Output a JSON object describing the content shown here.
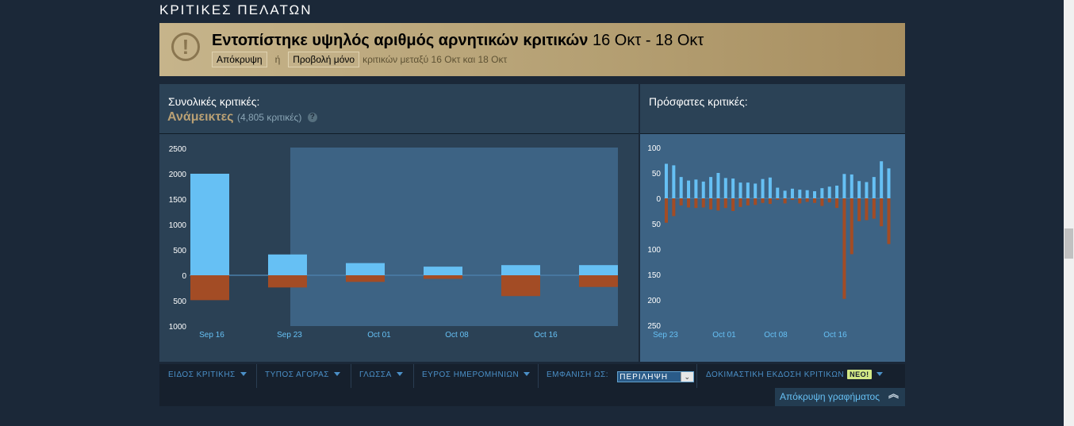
{
  "section_title": "ΚΡΙΤΙΚΕΣ ΠΕΛΑΤΩΝ",
  "warning": {
    "title_bold": "Εντοπίστηκε υψηλός αριθμός αρνητικών κριτικών",
    "date_range": "16 Οκτ - 18 Οκτ",
    "hide_button": "Απόκρυψη",
    "or_text": "ή",
    "show_only_button": "Προβολή μόνο",
    "range_note": "κριτικών μεταξύ 16 Οκτ και 18 Οκτ",
    "icon": "exclamation-circle-icon"
  },
  "overall": {
    "label": "Συνολικές κριτικές:",
    "summary": "Ανάμεικτες",
    "count": "(4,805 κριτικές)",
    "help": "?"
  },
  "recent": {
    "label": "Πρόσφατες κριτικές:"
  },
  "chart_data": [
    {
      "type": "bar",
      "title": "Συνολικές κριτικές",
      "y_ticks_positive": [
        "2500",
        "2000",
        "1500",
        "1000",
        "500",
        "0"
      ],
      "y_ticks_negative": [
        "500",
        "1000"
      ],
      "ylim": [
        -1000,
        2500
      ],
      "x_labels": [
        "Sep 16",
        "Sep 23",
        "Oct 01",
        "Oct 08",
        "Oct 16"
      ],
      "highlight_range": [
        "Sep 23",
        "Oct 16+"
      ],
      "series": [
        {
          "name": "positive",
          "color": "#66c0f4",
          "values": [
            2000,
            410,
            240,
            170,
            200,
            200
          ]
        },
        {
          "name": "negative",
          "color": "#a34c25",
          "values": [
            -490,
            -240,
            -130,
            -70,
            -410,
            -230
          ]
        }
      ],
      "grid": false
    },
    {
      "type": "bar",
      "title": "Πρόσφατες κριτικές",
      "y_ticks_positive": [
        "100",
        "50",
        "0"
      ],
      "y_ticks_negative": [
        "50",
        "100",
        "150",
        "200",
        "250"
      ],
      "ylim": [
        -250,
        100
      ],
      "x_labels": [
        "Sep 23",
        "Oct 01",
        "Oct 08",
        "Oct 16"
      ],
      "series": [
        {
          "name": "positive",
          "color": "#66c0f4",
          "values": [
            68,
            65,
            42,
            35,
            37,
            33,
            42,
            50,
            40,
            39,
            31,
            31,
            29,
            38,
            41,
            21,
            15,
            19,
            17,
            16,
            14,
            20,
            23,
            25,
            48,
            47,
            34,
            32,
            42,
            73,
            59
          ]
        },
        {
          "name": "negative",
          "color": "#a34c25",
          "values": [
            -48,
            -35,
            -14,
            -18,
            -19,
            -18,
            -22,
            -24,
            -19,
            -25,
            -17,
            -14,
            -13,
            -9,
            -11,
            -3,
            -10,
            -3,
            -10,
            -7,
            -9,
            -15,
            -8,
            -19,
            -198,
            -110,
            -45,
            -43,
            -40,
            -55,
            -90
          ]
        }
      ],
      "grid": false
    }
  ],
  "filters": {
    "review_type": "ΕΙΔΟΣ ΚΡΙΤΙΚΗΣ",
    "purchase_type": "ΤΥΠΟΣ ΑΓΟΡΑΣ",
    "language": "ΓΛΩΣΣΑ",
    "date_range": "ΕΥΡΟΣ ΗΜΕΡΟΜΗΝΙΩΝ",
    "display_as_label": "ΕΜΦΑΝΙΣΗ ΩΣ:",
    "display_as_value": "ΠΕΡΙΛΗΨΗ",
    "beta": "ΔΟΚΙΜΑΣΤΙΚΗ ΕΚΔΟΣΗ ΚΡΙΤΙΚΩΝ",
    "beta_badge": "ΝΕΟ!",
    "hide_graph": "Απόκρυψη γραφήματος"
  },
  "colors": {
    "positive": "#66c0f4",
    "negative": "#a34c25",
    "mixed": "#b9a074",
    "link": "#4b90c8"
  }
}
